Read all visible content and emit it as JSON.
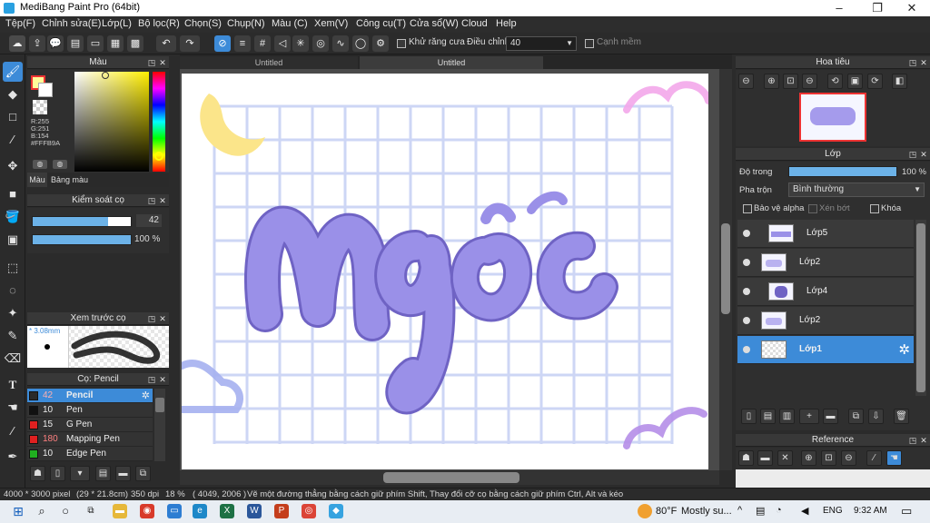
{
  "window": {
    "title": "MediBang Paint Pro (64bit)"
  },
  "menu": [
    "Tệp(F)",
    "Chỉnh sửa(E)",
    "Lớp(L)",
    "Bộ lọc(R)",
    "Chọn(S)",
    "Chụp(N)",
    "Màu (C)",
    "Xem(V)",
    "Công cụ(T)",
    "Cửa sổ(W)",
    "Cloud",
    "Help"
  ],
  "toolbar": {
    "antialias_label": "Khử răng cưa",
    "correction_label": "Điều chỉnh",
    "correction_value": "40",
    "soft_edge_label": "Cạnh mềm"
  },
  "tabs": [
    "Untitled",
    "Untitled"
  ],
  "color_panel": {
    "title": "Màu",
    "rgb": [
      "R:255",
      "G:251",
      "B:154"
    ],
    "hex": "#FFFB9A",
    "tab_color": "Màu",
    "tab_palette": "Bảng màu"
  },
  "brush_control": {
    "title": "Kiểm soát cọ",
    "size": "42",
    "opacity": "100 %",
    "size_fraction": 0.77,
    "opacity_fraction": 1.0
  },
  "brush_preview": {
    "title": "Xem trước cọ",
    "size_label": "3.08mm"
  },
  "brush_list": {
    "title": "Cọ: Pencil",
    "items": [
      {
        "size": "42",
        "name": "Pencil",
        "color": "#2a2a2a"
      },
      {
        "size": "10",
        "name": "Pen",
        "color": "#111111"
      },
      {
        "size": "15",
        "name": "G Pen",
        "color": "#e02020"
      },
      {
        "size": "180",
        "name": "Mapping Pen",
        "color": "#e02020"
      },
      {
        "size": "10",
        "name": "Edge Pen",
        "color": "#20b020"
      }
    ]
  },
  "navigator": {
    "title": "Hoa tiêu"
  },
  "layer_panel": {
    "title": "Lớp",
    "opacity_label": "Độ trong",
    "opacity_value": "100 %",
    "opacity_fraction": 1.0,
    "blend_label": "Pha trộn",
    "blend_value": "Bình thường",
    "protect_alpha": "Bảo vệ alpha",
    "clip": "Xén bớt",
    "lock": "Khóa",
    "layers": [
      "Lớp5",
      "Lớp2",
      "Lớp4",
      "Lớp2",
      "Lớp1"
    ]
  },
  "reference": {
    "title": "Reference"
  },
  "status": {
    "size": "4000 * 3000 pixel",
    "cm": "(29 * 21.8cm)",
    "dpi": "350 dpi",
    "zoom": "18 %",
    "coords": "( 4049, 2006 )",
    "hint": "Vẽ một đường thẳng bằng cách giữ phím Shift, Thay đổi cỡ cọ bằng cách giữ phím Ctrl, Alt và kéo"
  },
  "taskbar": {
    "temp": "80°F",
    "weather": "Mostly su...",
    "lang": "ENG",
    "time": "9:32 AM"
  },
  "colors": {
    "accent": "#3d8bd8",
    "foreground": "#FFFB9A",
    "lettering": "#9a90e8",
    "grid": "#cdd6f5"
  }
}
